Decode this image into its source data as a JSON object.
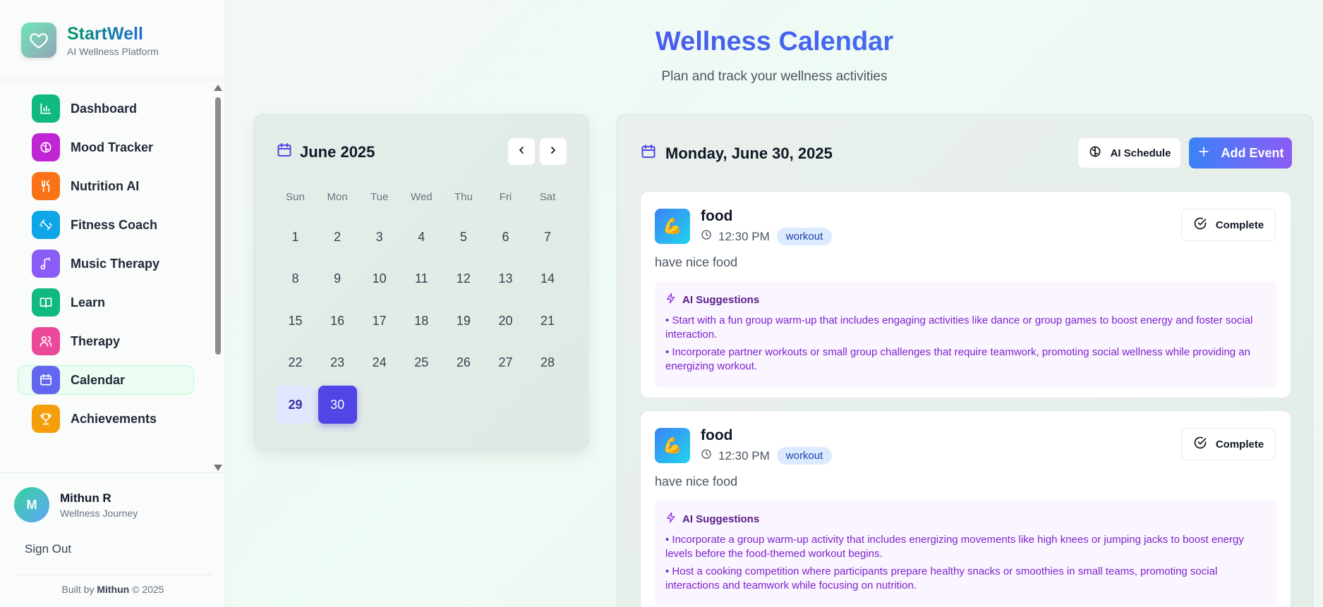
{
  "brand": {
    "name": "StartWell",
    "subtitle": "AI Wellness Platform"
  },
  "nav": {
    "items": [
      {
        "label": "Dashboard",
        "icon": "bar-chart-icon",
        "color": "#10b981"
      },
      {
        "label": "Mood Tracker",
        "icon": "brain-icon",
        "color": "#c026d3"
      },
      {
        "label": "Nutrition AI",
        "icon": "utensils-icon",
        "color": "#f97316"
      },
      {
        "label": "Fitness Coach",
        "icon": "dumbbell-icon",
        "color": "#0ea5e9"
      },
      {
        "label": "Music Therapy",
        "icon": "music-note-icon",
        "color": "#8b5cf6"
      },
      {
        "label": "Learn",
        "icon": "book-icon",
        "color": "#10b981"
      },
      {
        "label": "Therapy",
        "icon": "users-icon",
        "color": "#ec4899"
      },
      {
        "label": "Calendar",
        "icon": "calendar-icon",
        "color": "#6366f1",
        "active": true
      },
      {
        "label": "Achievements",
        "icon": "trophy-icon",
        "color": "#f59e0b"
      }
    ]
  },
  "user": {
    "initial": "M",
    "name": "Mithun R",
    "subtitle": "Wellness Journey"
  },
  "signout_label": "Sign Out",
  "footer": {
    "prefix": "Built by",
    "author": "Mithun",
    "suffix": "© 2025"
  },
  "header": {
    "title": "Wellness Calendar",
    "subtitle": "Plan and track your wellness activities"
  },
  "calendar": {
    "month_label": "June 2025",
    "weekdays": [
      "Sun",
      "Mon",
      "Tue",
      "Wed",
      "Thu",
      "Fri",
      "Sat"
    ],
    "weeks": [
      [
        "1",
        "2",
        "3",
        "4",
        "5",
        "6",
        "7"
      ],
      [
        "8",
        "9",
        "10",
        "11",
        "12",
        "13",
        "14"
      ],
      [
        "15",
        "16",
        "17",
        "18",
        "19",
        "20",
        "21"
      ],
      [
        "22",
        "23",
        "24",
        "25",
        "26",
        "27",
        "28"
      ],
      [
        "29",
        "30",
        "",
        "",
        "",
        "",
        ""
      ]
    ],
    "today": "29",
    "selected": "30"
  },
  "events_panel": {
    "date_label": "Monday, June 30, 2025",
    "ai_schedule_label": "AI Schedule",
    "add_event_label": "Add Event",
    "events": [
      {
        "emoji": "💪",
        "title": "food",
        "time": "12:30 PM",
        "tag": "workout",
        "description": "have nice food",
        "complete_label": "Complete",
        "ai_title": "AI Suggestions",
        "suggestions": [
          "• Start with a fun group warm-up that includes engaging activities like dance or group games to boost energy and foster social interaction.",
          "• Incorporate partner workouts or small group challenges that require teamwork, promoting social wellness while providing an energizing workout."
        ]
      },
      {
        "emoji": "💪",
        "title": "food",
        "time": "12:30 PM",
        "tag": "workout",
        "description": "have nice food",
        "complete_label": "Complete",
        "ai_title": "AI Suggestions",
        "suggestions": [
          "• Incorporate a group warm-up activity that includes energizing movements like high knees or jumping jacks to boost energy levels before the food-themed workout begins.",
          "• Host a cooking competition where participants prepare healthy snacks or smoothies in small teams, promoting social interactions and teamwork while focusing on nutrition."
        ]
      }
    ]
  }
}
